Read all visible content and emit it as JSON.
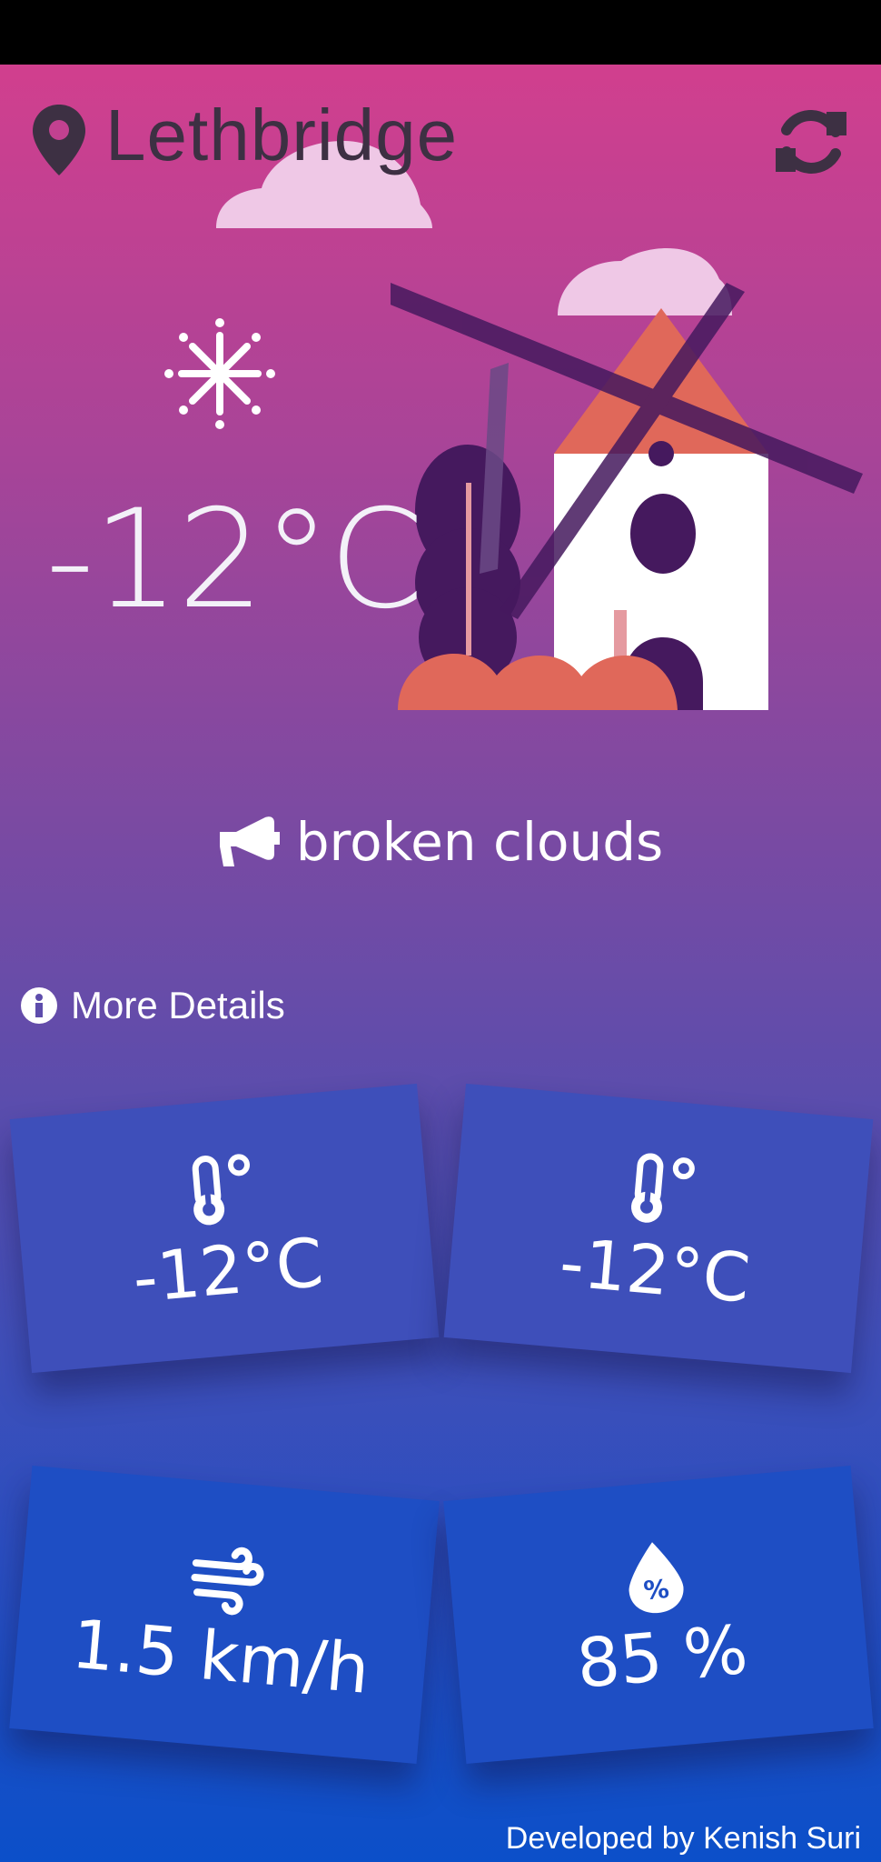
{
  "header": {
    "city": "Lethbridge"
  },
  "current": {
    "temperature": "-12°C",
    "description": "broken clouds"
  },
  "details_link": "More Details",
  "cards": [
    {
      "icon": "thermometer-icon",
      "value": "-12°C"
    },
    {
      "icon": "thermometer-icon",
      "value": "-12°C"
    },
    {
      "icon": "wind-icon",
      "value": "1.5 km/h"
    },
    {
      "icon": "humidity-drop-icon",
      "value": "85 %"
    }
  ],
  "footer": "Developed by Kenish Suri",
  "colors": {
    "gradient_top": "#d13f8e",
    "gradient_bottom": "#0b4fc9",
    "city_text": "#3d3043",
    "windmill_roof": "#e0685a",
    "windmill_dark": "#45195e"
  }
}
